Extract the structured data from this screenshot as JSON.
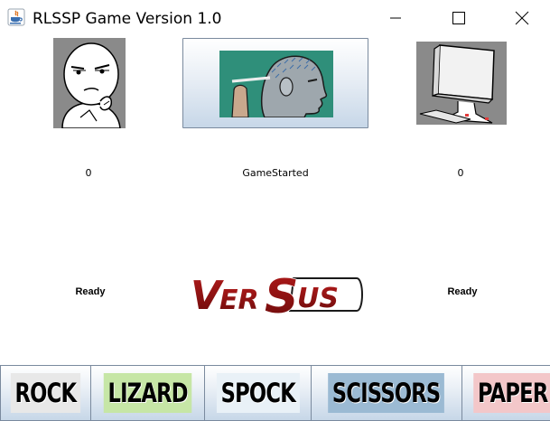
{
  "window": {
    "title": "RLSSP Game Version 1.0"
  },
  "player": {
    "score": "0",
    "state": "Ready"
  },
  "computer": {
    "score": "0",
    "state": "Ready"
  },
  "game": {
    "status": "GameStarted",
    "versus_text": "VERSUS"
  },
  "choices": [
    {
      "label": "ROCK",
      "color": "#e8e8e8"
    },
    {
      "label": "LIZARD",
      "color": "#c6e6a6"
    },
    {
      "label": "SPOCK",
      "color": "#e9f1f7"
    },
    {
      "label": "SCISSORS",
      "color": "#9bbad3"
    },
    {
      "label": "PAPER",
      "color": "#f3c7c9"
    }
  ],
  "icons": {
    "app": "java-cup-icon",
    "player": "thinking-meme-face-icon",
    "center": "thinking-head-icon",
    "computer": "computer-monitor-icon"
  }
}
